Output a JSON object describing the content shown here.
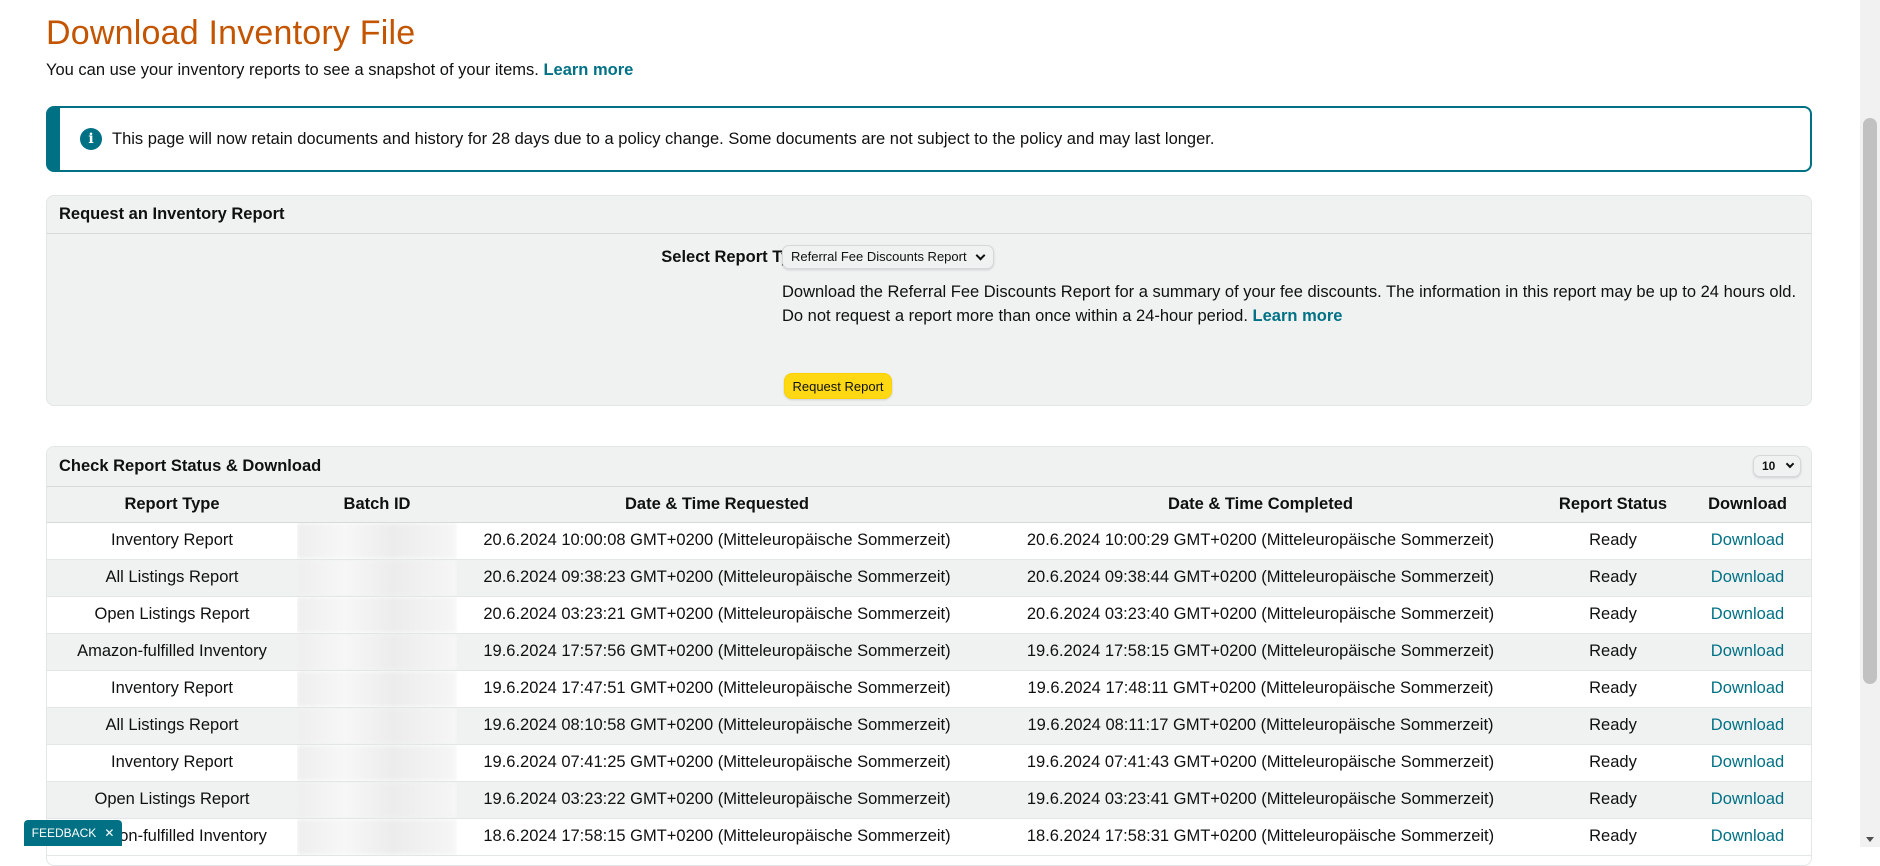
{
  "page": {
    "title": "Download Inventory File",
    "subtitle": "You can use your inventory reports to see a snapshot of your items.",
    "learn_more": "Learn more"
  },
  "notice": {
    "icon": "info-icon",
    "text": "This page will now retain documents and history for 28 days due to a policy change. Some documents are not subject to the policy and may last longer."
  },
  "request": {
    "header": "Request an Inventory Report",
    "select_label": "Select Report Type:",
    "selected_type": "Referral Fee Discounts Report",
    "description": "Download the Referral Fee Discounts Report for a summary of your fee discounts. The information in this report may be up to 24 hours old. Do not request a report more than once within a 24-hour period.",
    "learn_more": "Learn more",
    "button_label": "Request Report"
  },
  "status": {
    "header": "Check Report Status & Download",
    "page_size": "10",
    "columns": [
      "Report Type",
      "Batch ID",
      "Date & Time Requested",
      "Date & Time Completed",
      "Report Status",
      "Download"
    ],
    "rows": [
      {
        "type": "Inventory Report",
        "requested": "20.6.2024 10:00:08 GMT+0200 (Mitteleuropäische Sommerzeit)",
        "completed": "20.6.2024 10:00:29 GMT+0200 (Mitteleuropäische Sommerzeit)",
        "status": "Ready",
        "download": "Download"
      },
      {
        "type": "All Listings Report",
        "requested": "20.6.2024 09:38:23 GMT+0200 (Mitteleuropäische Sommerzeit)",
        "completed": "20.6.2024 09:38:44 GMT+0200 (Mitteleuropäische Sommerzeit)",
        "status": "Ready",
        "download": "Download"
      },
      {
        "type": "Open Listings Report",
        "requested": "20.6.2024 03:23:21 GMT+0200 (Mitteleuropäische Sommerzeit)",
        "completed": "20.6.2024 03:23:40 GMT+0200 (Mitteleuropäische Sommerzeit)",
        "status": "Ready",
        "download": "Download"
      },
      {
        "type": "Amazon-fulfilled Inventory",
        "requested": "19.6.2024 17:57:56 GMT+0200 (Mitteleuropäische Sommerzeit)",
        "completed": "19.6.2024 17:58:15 GMT+0200 (Mitteleuropäische Sommerzeit)",
        "status": "Ready",
        "download": "Download"
      },
      {
        "type": "Inventory Report",
        "requested": "19.6.2024 17:47:51 GMT+0200 (Mitteleuropäische Sommerzeit)",
        "completed": "19.6.2024 17:48:11 GMT+0200 (Mitteleuropäische Sommerzeit)",
        "status": "Ready",
        "download": "Download"
      },
      {
        "type": "All Listings Report",
        "requested": "19.6.2024 08:10:58 GMT+0200 (Mitteleuropäische Sommerzeit)",
        "completed": "19.6.2024 08:11:17 GMT+0200 (Mitteleuropäische Sommerzeit)",
        "status": "Ready",
        "download": "Download"
      },
      {
        "type": "Inventory Report",
        "requested": "19.6.2024 07:41:25 GMT+0200 (Mitteleuropäische Sommerzeit)",
        "completed": "19.6.2024 07:41:43 GMT+0200 (Mitteleuropäische Sommerzeit)",
        "status": "Ready",
        "download": "Download"
      },
      {
        "type": "Open Listings Report",
        "requested": "19.6.2024 03:23:22 GMT+0200 (Mitteleuropäische Sommerzeit)",
        "completed": "19.6.2024 03:23:41 GMT+0200 (Mitteleuropäische Sommerzeit)",
        "status": "Ready",
        "download": "Download"
      },
      {
        "type": "Amazon-fulfilled Inventory",
        "requested": "18.6.2024 17:58:15 GMT+0200 (Mitteleuropäische Sommerzeit)",
        "completed": "18.6.2024 17:58:31 GMT+0200 (Mitteleuropäische Sommerzeit)",
        "status": "Ready",
        "download": "Download"
      }
    ]
  },
  "feedback": {
    "label": "FEEDBACK",
    "close_icon": "close-icon"
  },
  "colors": {
    "title": "#c45500",
    "link": "#007185",
    "accent_button": "#ffd814",
    "panel_bg": "#f0f2f2"
  }
}
